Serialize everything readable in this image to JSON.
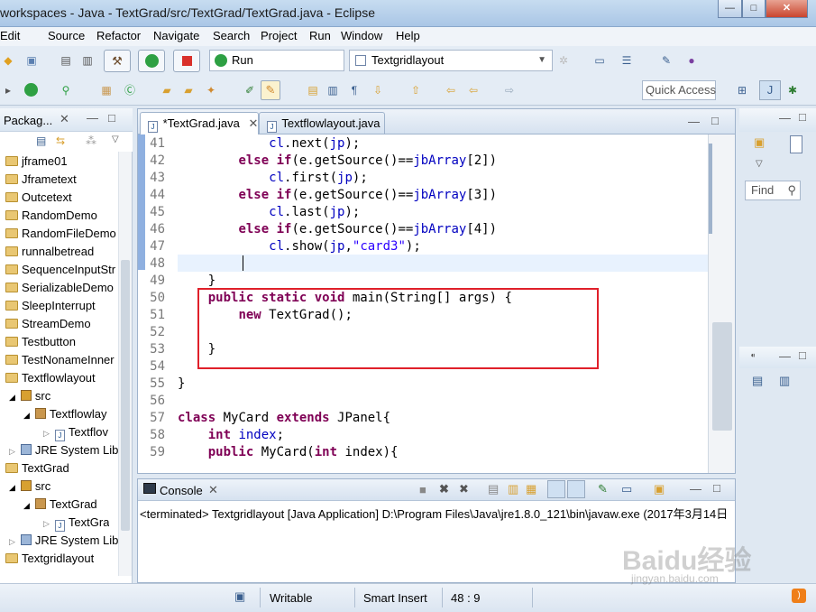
{
  "window": {
    "title": "workspaces - Java - TextGrad/src/TextGrad/TextGrad.java - Eclipse",
    "minimize": "—",
    "maximize": "□",
    "close": "✕"
  },
  "menu": [
    "Edit",
    "Source",
    "Refactor",
    "Navigate",
    "Search",
    "Project",
    "Run",
    "Window",
    "Help"
  ],
  "toolbar": {
    "run_label": "Run",
    "launch_config": "Textgridlayout",
    "quick_access": "Quick Access"
  },
  "explorer": {
    "tab_label": "Packag...",
    "items": [
      "jframe01",
      "Jframetext",
      "Outcetext",
      "RandomDemo",
      "RandomFileDemo",
      "runnalbetread",
      "SequenceInputStr",
      "SerializableDemo",
      "SleepInterrupt",
      "StreamDemo",
      "Testbutton",
      "TestNonameInner",
      "Textflowlayout",
      "src",
      "Textflowlay",
      "Textflov",
      "JRE System Lib",
      "TextGrad",
      "src",
      "TextGrad",
      "TextGra",
      "JRE System Lib",
      "Textgridlayout"
    ]
  },
  "editor": {
    "tabs": [
      "*TextGrad.java",
      "Textflowlayout.java"
    ],
    "lines": [
      {
        "n": "41",
        "parts": [
          [
            "",
            "            "
          ],
          [
            "fld",
            "cl"
          ],
          [
            "",
            ".next("
          ],
          [
            "fld",
            "jp"
          ],
          [
            "",
            ");"
          ]
        ]
      },
      {
        "n": "42",
        "parts": [
          [
            "",
            "        "
          ],
          [
            "kw",
            "else if"
          ],
          [
            "",
            "(e.getSource()=="
          ],
          [
            "fld",
            "jbArray"
          ],
          [
            "",
            "[2])"
          ]
        ]
      },
      {
        "n": "43",
        "parts": [
          [
            "",
            "            "
          ],
          [
            "fld",
            "cl"
          ],
          [
            "",
            ".first("
          ],
          [
            "fld",
            "jp"
          ],
          [
            "",
            ");"
          ]
        ]
      },
      {
        "n": "44",
        "parts": [
          [
            "",
            "        "
          ],
          [
            "kw",
            "else if"
          ],
          [
            "",
            "(e.getSource()=="
          ],
          [
            "fld",
            "jbArray"
          ],
          [
            "",
            "[3])"
          ]
        ]
      },
      {
        "n": "45",
        "parts": [
          [
            "",
            "            "
          ],
          [
            "fld",
            "cl"
          ],
          [
            "",
            ".last("
          ],
          [
            "fld",
            "jp"
          ],
          [
            "",
            ");"
          ]
        ]
      },
      {
        "n": "46",
        "parts": [
          [
            "",
            "        "
          ],
          [
            "kw",
            "else if"
          ],
          [
            "",
            "(e.getSource()=="
          ],
          [
            "fld",
            "jbArray"
          ],
          [
            "",
            "[4])"
          ]
        ]
      },
      {
        "n": "47",
        "parts": [
          [
            "",
            "            "
          ],
          [
            "fld",
            "cl"
          ],
          [
            "",
            ".show("
          ],
          [
            "fld",
            "jp"
          ],
          [
            "",
            ","
          ],
          [
            "str",
            "\"card3\""
          ],
          [
            "",
            ");"
          ]
        ]
      },
      {
        "n": "48",
        "parts": [
          [
            "",
            "        "
          ]
        ]
      },
      {
        "n": "49",
        "parts": [
          [
            "",
            "    }"
          ]
        ]
      },
      {
        "n": "50",
        "parts": [
          [
            "",
            "    "
          ],
          [
            "kw",
            "public static void"
          ],
          [
            "",
            " main(String[] args) {"
          ]
        ]
      },
      {
        "n": "51",
        "parts": [
          [
            "",
            "        "
          ],
          [
            "kw",
            "new"
          ],
          [
            "",
            " TextGrad();"
          ]
        ]
      },
      {
        "n": "52",
        "parts": [
          [
            "",
            ""
          ]
        ]
      },
      {
        "n": "53",
        "parts": [
          [
            "",
            "    }"
          ]
        ]
      },
      {
        "n": "54",
        "parts": [
          [
            "",
            ""
          ]
        ]
      },
      {
        "n": "55",
        "parts": [
          [
            "",
            "}"
          ]
        ]
      },
      {
        "n": "56",
        "parts": [
          [
            "",
            ""
          ]
        ]
      },
      {
        "n": "57",
        "parts": [
          [
            "kw",
            "class"
          ],
          [
            "",
            " MyCard "
          ],
          [
            "kw",
            "extends"
          ],
          [
            "",
            " JPanel{"
          ]
        ]
      },
      {
        "n": "58",
        "parts": [
          [
            "",
            "    "
          ],
          [
            "kw",
            "int"
          ],
          [
            "",
            " "
          ],
          [
            "fld",
            "index"
          ],
          [
            "",
            ";"
          ]
        ]
      },
      {
        "n": "59",
        "parts": [
          [
            "",
            "    "
          ],
          [
            "kw",
            "public"
          ],
          [
            "",
            " MyCard("
          ],
          [
            "kw",
            "int"
          ],
          [
            "",
            " index){"
          ]
        ]
      }
    ]
  },
  "right_panel": {
    "find_label": "Find"
  },
  "console": {
    "tab_label": "Console",
    "output": "<terminated> Textgridlayout [Java Application] D:\\Program Files\\Java\\jre1.8.0_121\\bin\\javaw.exe (2017年3月14日"
  },
  "status": {
    "writable": "Writable",
    "insert_mode": "Smart Insert",
    "position": "48 : 9"
  },
  "watermark": {
    "brand": "Baidu经验",
    "url": "jingyan.baidu.com"
  }
}
